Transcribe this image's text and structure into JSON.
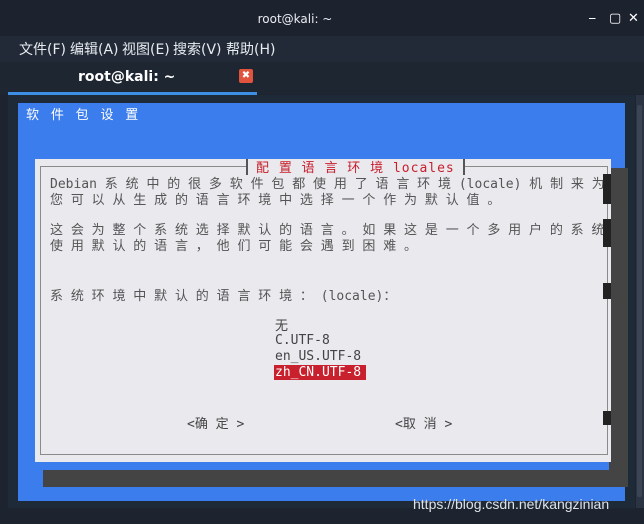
{
  "window": {
    "title": "root@kali: ~"
  },
  "menubar": {
    "items": [
      "文件(F)",
      "编辑(A)",
      "视图(E)",
      "搜索(V)",
      "帮助(H)"
    ]
  },
  "tab": {
    "label": "root@kali: ~",
    "close": "✖"
  },
  "terminal": {
    "backtitle": "软 件 包 设 置",
    "dialog": {
      "title": "配 置 语 言 环 境 locales",
      "desc1": "Debian 系 统 中 的 很 多 软 件 包 都 使 用 了 语 言 环 境 (locale) 机 制 来 为 用 户 显 示 消 息 文 本 。",
      "desc2": "您 可 以 从 生 成 的 语 言 环 境 中 选 择 一 个 作 为 默 认 值 。",
      "desc3": "这 会 为 整 个 系 统 选 择 默 认 的 语 言 。 如 果 这 是 一 个 多 用 户 的 系 统 ， 而 且 不 是 所 有 的 用 户 都 能",
      "desc4": "使 用 默 认 的 语 言 ， 他 们 可 能 会 遇 到 困 难 。",
      "question": "系 统 环 境 中 默 认 的 语 言 环 境 ： (locale)：",
      "options": [
        "无",
        "C.UTF-8",
        "en_US.UTF-8"
      ],
      "selected_option": "zh_CN.UTF-8",
      "ok_button": "<确 定 >",
      "cancel_button": "<取 消 >"
    }
  },
  "watermark": "https://blog.csdn.net/kangzinian"
}
